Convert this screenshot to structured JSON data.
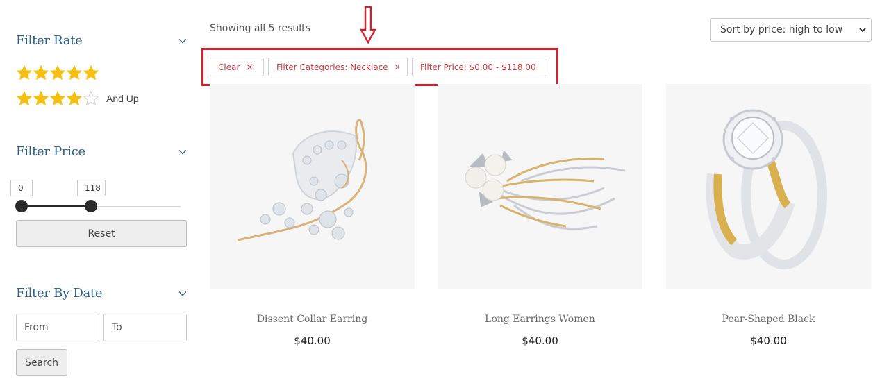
{
  "sidebar": {
    "filter_rate": {
      "title": "Filter Rate",
      "rows": [
        {
          "rating": 5,
          "of": 5,
          "label": ""
        },
        {
          "rating": 4,
          "of": 5,
          "label": "And Up"
        }
      ]
    },
    "filter_price": {
      "title": "Filter Price",
      "min_value": "0",
      "max_value": "118",
      "range_min": 0,
      "range_max": 118,
      "reset_label": "Reset"
    },
    "filter_date": {
      "title": "Filter By Date",
      "from_placeholder": "From",
      "to_placeholder": "To",
      "search_label": "Search"
    }
  },
  "main": {
    "results_text": "Showing all 5 results",
    "sort": {
      "selected": "Sort by price: high to low"
    },
    "active_filters": [
      {
        "label": "Clear"
      },
      {
        "label": "Filter Categories: Necklace"
      },
      {
        "label": "Filter Price: $0.00 - $118.00"
      }
    ],
    "products": [
      {
        "name": "Dissent Collar Earring",
        "price": "$40.00",
        "image": "gold-leaf-crystal-brooch"
      },
      {
        "name": "Long Earrings Women",
        "price": "$40.00",
        "image": "pearl-flower-brooch"
      },
      {
        "name": "Pear-Shaped Black",
        "price": "$40.00",
        "image": "diamond-ring"
      }
    ]
  },
  "colors": {
    "heading": "#2f5f84",
    "star": "#f6c012",
    "chip_text": "#c6383f",
    "highlight": "#d4202d"
  },
  "icons": [
    "chevron-down-icon",
    "star-icon",
    "close-icon",
    "down-arrow-icon"
  ]
}
